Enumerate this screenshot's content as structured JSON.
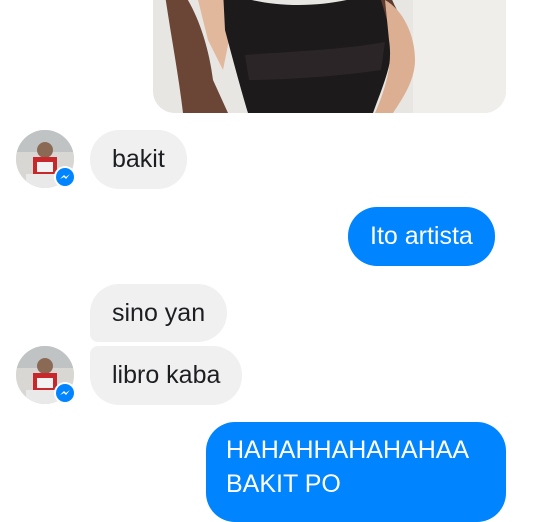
{
  "conversation": {
    "messages": [
      {
        "text": "bakit"
      },
      {
        "text": "Ito artista"
      },
      {
        "text": "sino yan"
      },
      {
        "text": "libro kaba"
      },
      {
        "line1": "HAHAHHAHAHAHAA",
        "line2": "BAKIT PO"
      }
    ]
  },
  "colors": {
    "sent_bubble": "#0084ff",
    "received_bubble": "#f0f0f0",
    "messenger_badge": "#0084ff"
  },
  "icons": {
    "avatar_badge": "messenger-icon"
  }
}
